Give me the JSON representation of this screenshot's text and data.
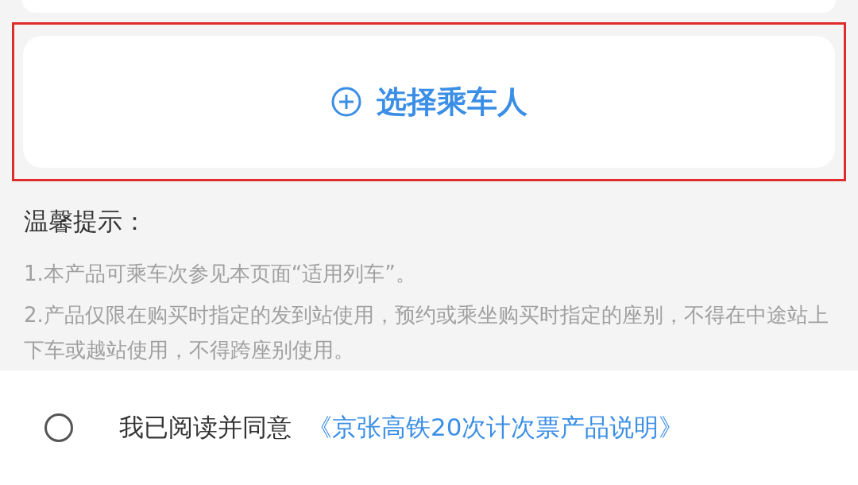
{
  "select_passenger": {
    "label": "选择乘车人",
    "highlighted": true
  },
  "tips": {
    "title": "温馨提示：",
    "items": [
      "1.本产品可乘车次参见本页面“适用列车”。",
      "2.产品仅限在购买时指定的发到站使用，预约或乘坐购买时指定的座别，不得在中途站上下车或越站使用，不得跨座别使用。"
    ]
  },
  "agreement": {
    "checked": false,
    "text": "我已阅读并同意",
    "link": "《京张高铁20次计次票产品说明》"
  }
}
